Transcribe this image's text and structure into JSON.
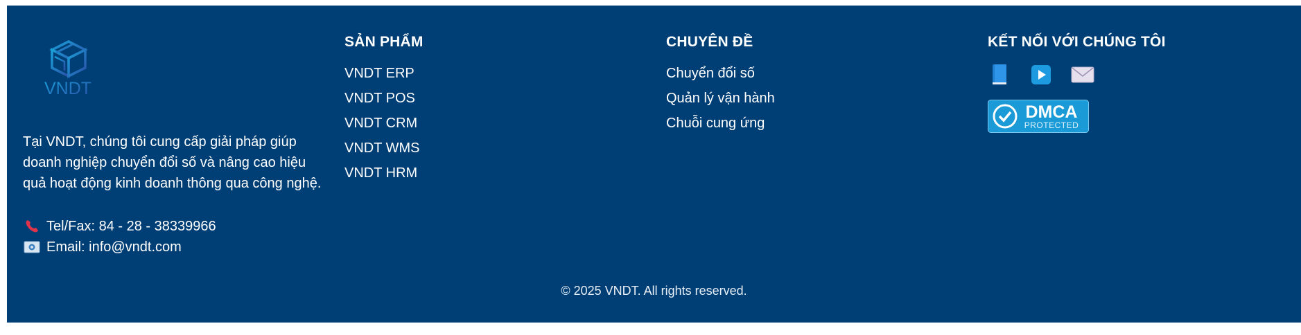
{
  "brand": {
    "logo_text": "VNDT",
    "about": "Tại VNDT, chúng tôi cung cấp giải pháp giúp doanh nghiệp chuyển đổi số và nâng cao hiệu quả hoạt động kinh doanh thông qua công nghệ.",
    "phone": "Tel/Fax: 84 - 28 - 38339966",
    "email": "Email: info@vndt.com",
    "phone_icon": "telephone-receiver-icon",
    "email_icon": "email-envelope-icon"
  },
  "products": {
    "heading": "SẢN PHẨM",
    "items": [
      "VNDT ERP",
      "VNDT POS",
      "VNDT CRM",
      "VNDT WMS",
      "VNDT HRM"
    ]
  },
  "topics": {
    "heading": "CHUYÊN ĐỀ",
    "items": [
      "Chuyển đổi số",
      "Quản lý vận hành",
      "Chuỗi cung ứng"
    ]
  },
  "connect": {
    "heading": "KẾT NỐI VỚI CHÚNG TÔI",
    "icons": [
      "facebook-book-icon",
      "youtube-play-icon",
      "mail-envelope-icon"
    ],
    "dmca": {
      "line1": "DMCA",
      "line2": "PROTECTED"
    }
  },
  "copyright": "© 2025 VNDT. All rights reserved.",
  "colors": {
    "background": "#003f75",
    "text": "#ffffff",
    "logo_gradient_start": "#1aa0d8",
    "logo_gradient_end": "#2b4fa8",
    "dmca_blue": "#1a9ad6"
  }
}
